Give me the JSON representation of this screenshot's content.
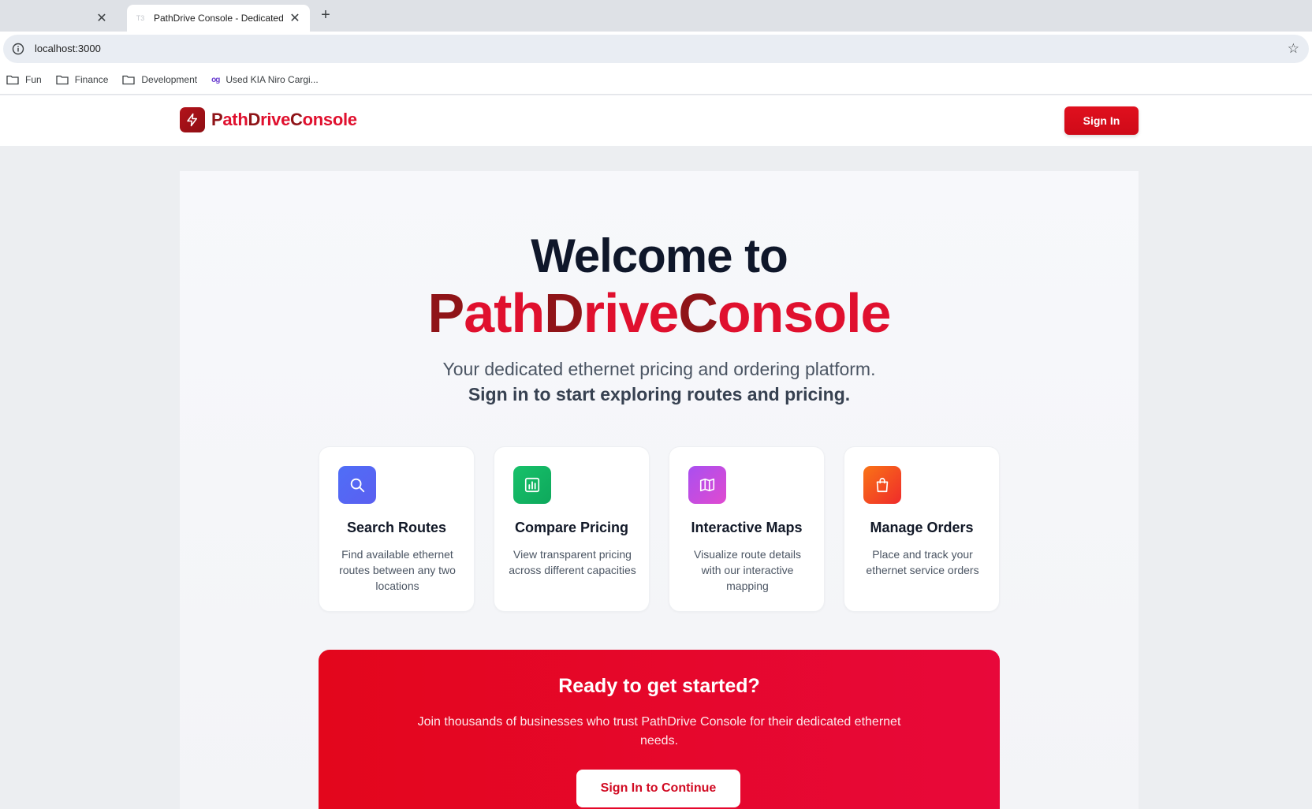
{
  "browser": {
    "tabs": [
      {
        "title": ""
      },
      {
        "title": "PathDrive Console - Dedicated Ethernet",
        "favicon": "T3"
      }
    ],
    "url": "localhost:3000",
    "bookmarks": [
      {
        "label": "Fun",
        "icon": "folder-icon"
      },
      {
        "label": "Finance",
        "icon": "folder-icon"
      },
      {
        "label": "Development",
        "icon": "folder-icon"
      },
      {
        "label": "Used KIA Niro Cargi...",
        "icon": "og-icon",
        "badge": "og"
      }
    ]
  },
  "header": {
    "brand": {
      "p1": "P",
      "p2": "ath",
      "p3": "D",
      "p4": "rive",
      "p5": "C",
      "p6": "onsole"
    },
    "signin_label": "Sign In"
  },
  "hero": {
    "welcome": "Welcome to",
    "brand": {
      "p1": "P",
      "p2": "ath",
      "p3": "D",
      "p4": "rive",
      "p5": "C",
      "p6": "onsole"
    },
    "tagline": "Your dedicated ethernet pricing and ordering platform.",
    "tagline_bold": "Sign in to start exploring routes and pricing."
  },
  "features": [
    {
      "title": "Search Routes",
      "desc": "Find available ethernet routes between any two locations",
      "icon": "search-icon",
      "color": "#4f6ef7"
    },
    {
      "title": "Compare Pricing",
      "desc": "View transparent pricing across different capacities",
      "icon": "bar-chart-icon",
      "color": "#12b76a"
    },
    {
      "title": "Interactive Maps",
      "desc": "Visualize route details with our interactive mapping",
      "icon": "map-icon",
      "color": "#c44ad6"
    },
    {
      "title": "Manage Orders",
      "desc": "Place and track your ethernet service orders",
      "icon": "shopping-bag-icon",
      "color": "#f04a22"
    }
  ],
  "cta": {
    "title": "Ready to get started?",
    "text": "Join thousands of businesses who trust PathDrive Console for their dedicated ethernet needs.",
    "button": "Sign In to Continue"
  },
  "colors": {
    "brand_dark": "#8f1418",
    "brand_red": "#e0102e",
    "cta": "#e3061c"
  }
}
